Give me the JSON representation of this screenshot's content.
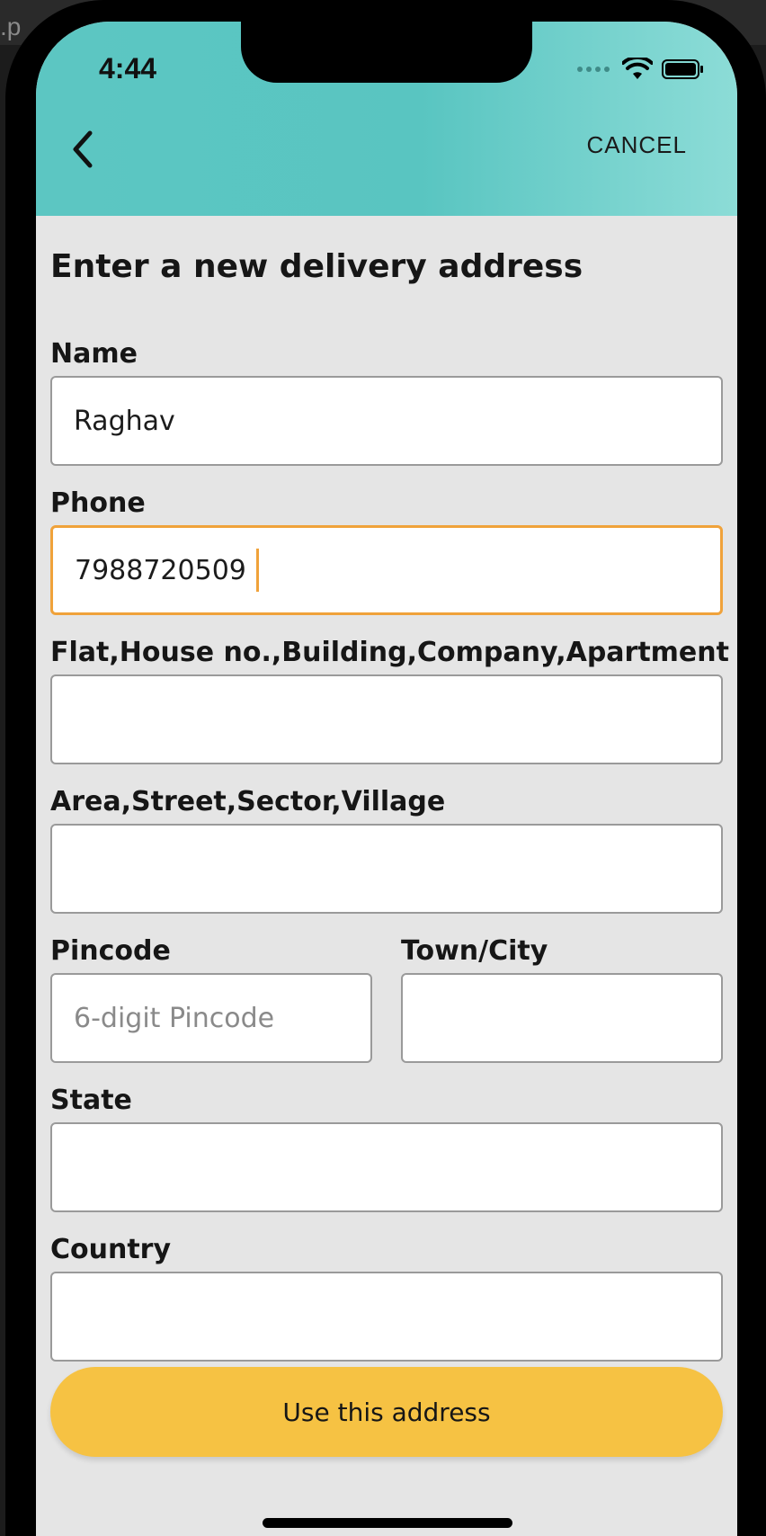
{
  "status_bar": {
    "time": "4:44"
  },
  "header": {
    "cancel_label": "CANCEL"
  },
  "page": {
    "title": "Enter a new delivery address"
  },
  "form": {
    "name": {
      "label": "Name",
      "value": "Raghav"
    },
    "phone": {
      "label": "Phone",
      "value": "7988720509"
    },
    "flat": {
      "label": "Flat,House no.,Building,Company,Apartment",
      "value": ""
    },
    "area": {
      "label": "Area,Street,Sector,Village",
      "value": ""
    },
    "pincode": {
      "label": "Pincode",
      "value": "",
      "placeholder": "6-digit Pincode"
    },
    "city": {
      "label": "Town/City",
      "value": ""
    },
    "state": {
      "label": "State",
      "value": ""
    },
    "country": {
      "label": "Country",
      "value": ""
    }
  },
  "submit": {
    "label": "Use this address"
  },
  "colors": {
    "header": "#5cc6c2",
    "focus": "#f0a23a",
    "button": "#f6c243",
    "background": "#e5e5e5"
  },
  "icons": {
    "back": "chevron-left-icon",
    "wifi": "wifi-icon",
    "battery": "battery-icon"
  }
}
